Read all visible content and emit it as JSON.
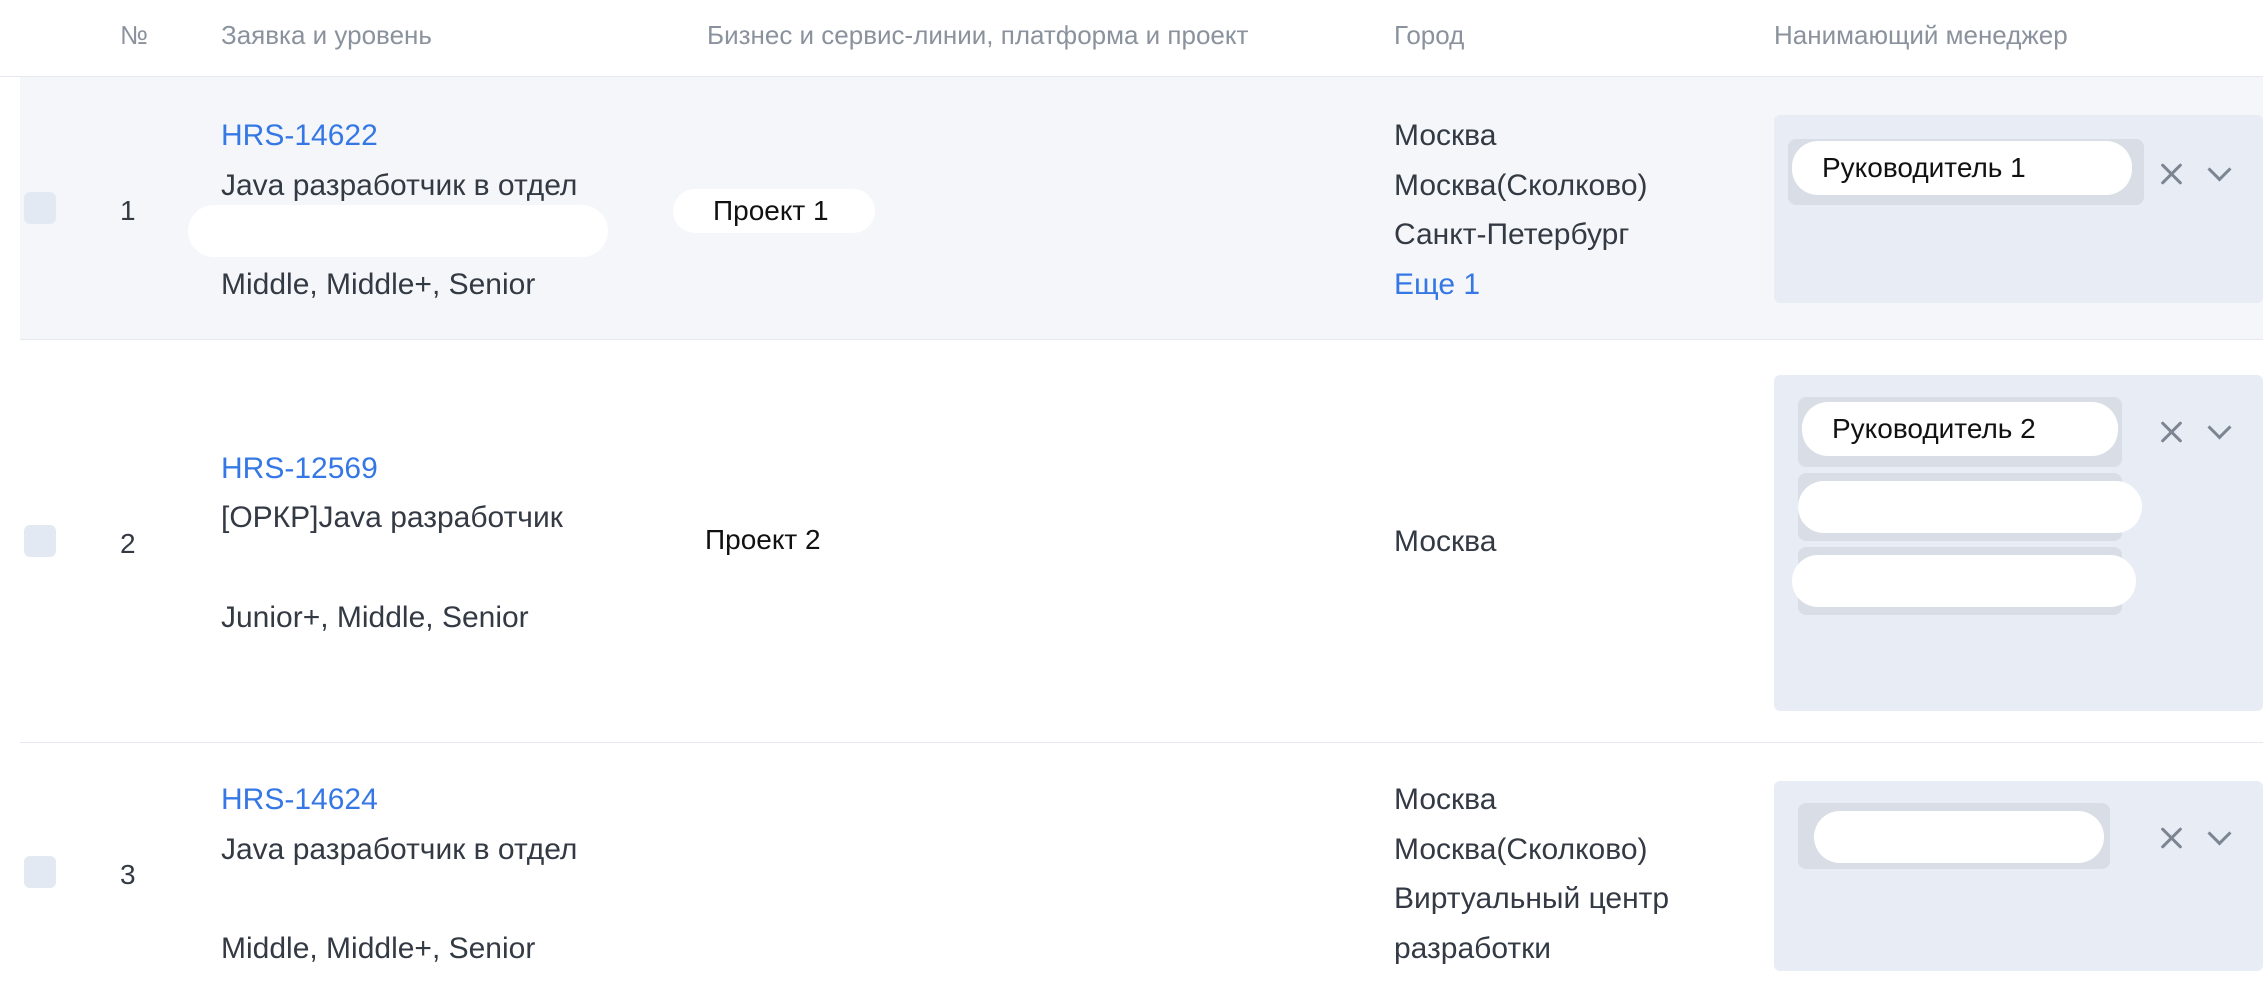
{
  "table": {
    "columns": {
      "num": "№",
      "request": "Заявка и уровень",
      "business": "Бизнес и сервис-линии, платформа и проект",
      "city": "Город",
      "manager": "Нанимающий менеджер"
    },
    "rows": [
      {
        "num": "1",
        "request_id": "HRS-14622",
        "title": "Java разработчик в отдел",
        "levels": "Middle, Middle+, Senior",
        "project": "Проект 1",
        "cities": [
          "Москва",
          "Москва(Сколково)",
          "Санкт-Петербург"
        ],
        "more_cities": "Еще 1",
        "manager": "Руководитель 1"
      },
      {
        "num": "2",
        "request_id": "HRS-12569",
        "title": "[ОРКР]Java разработчик",
        "levels": "Junior+, Middle, Senior",
        "project": "Проект 2",
        "cities": [
          "Москва"
        ],
        "manager": "Руководитель 2"
      },
      {
        "num": "3",
        "request_id": "HRS-14624",
        "title": "Java разработчик в отдел",
        "levels": "Middle, Middle+, Senior",
        "cities": [
          "Москва",
          "Москва(Сколково)",
          "Виртуальный центр",
          "разработки"
        ]
      }
    ]
  },
  "icons": {
    "clear": "close-icon",
    "expand": "chevron-down-icon"
  }
}
